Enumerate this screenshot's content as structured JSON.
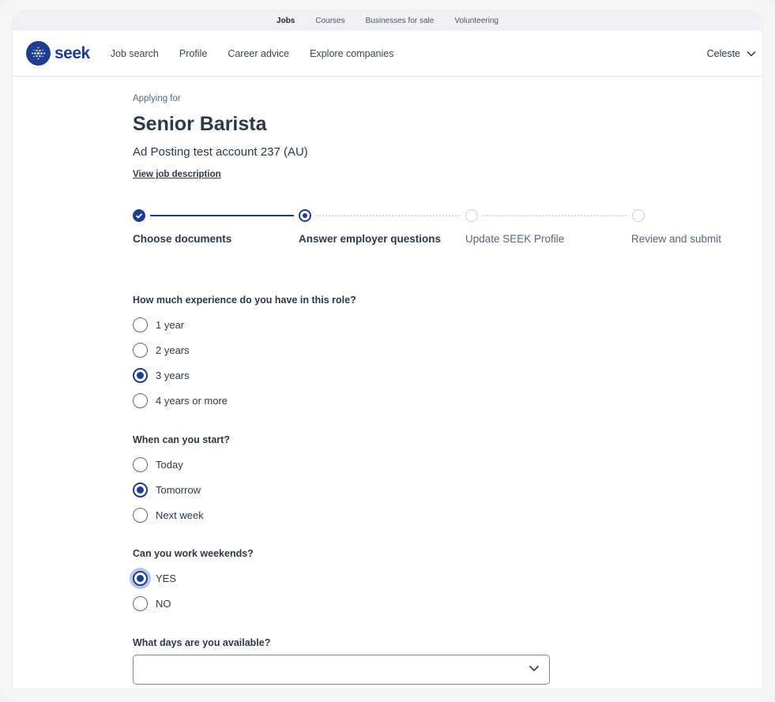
{
  "utility_nav": [
    {
      "label": "Jobs",
      "active": true
    },
    {
      "label": "Courses",
      "active": false
    },
    {
      "label": "Businesses for sale",
      "active": false
    },
    {
      "label": "Volunteering",
      "active": false
    }
  ],
  "header": {
    "logo_text": "seek",
    "nav": [
      "Job search",
      "Profile",
      "Career advice",
      "Explore companies"
    ],
    "user_name": "Celeste"
  },
  "job": {
    "applying_for": "Applying for",
    "title": "Senior Barista",
    "employer": "Ad Posting test account 237 (AU)",
    "view_description": "View job description"
  },
  "stepper": {
    "steps": [
      {
        "label": "Choose documents",
        "state": "done"
      },
      {
        "label": "Answer employer questions",
        "state": "current"
      },
      {
        "label": "Update SEEK Profile",
        "state": "todo"
      },
      {
        "label": "Review and submit",
        "state": "todo"
      }
    ]
  },
  "questions": [
    {
      "label": "How much experience do you have in this role?",
      "options": [
        "1 year",
        "2 years",
        "3 years",
        "4 years or more"
      ],
      "selected": "3 years"
    },
    {
      "label": "When can you start?",
      "options": [
        "Today",
        "Tomorrow",
        "Next week"
      ],
      "selected": "Tomorrow"
    },
    {
      "label": "Can you work weekends?",
      "options": [
        "YES",
        "NO"
      ],
      "selected": "YES"
    }
  ],
  "days_question": {
    "label": "What days are you available?",
    "value": ""
  },
  "colors": {
    "brand": "#1e3d8f",
    "text": "#2e3849",
    "muted": "#5a6474"
  }
}
